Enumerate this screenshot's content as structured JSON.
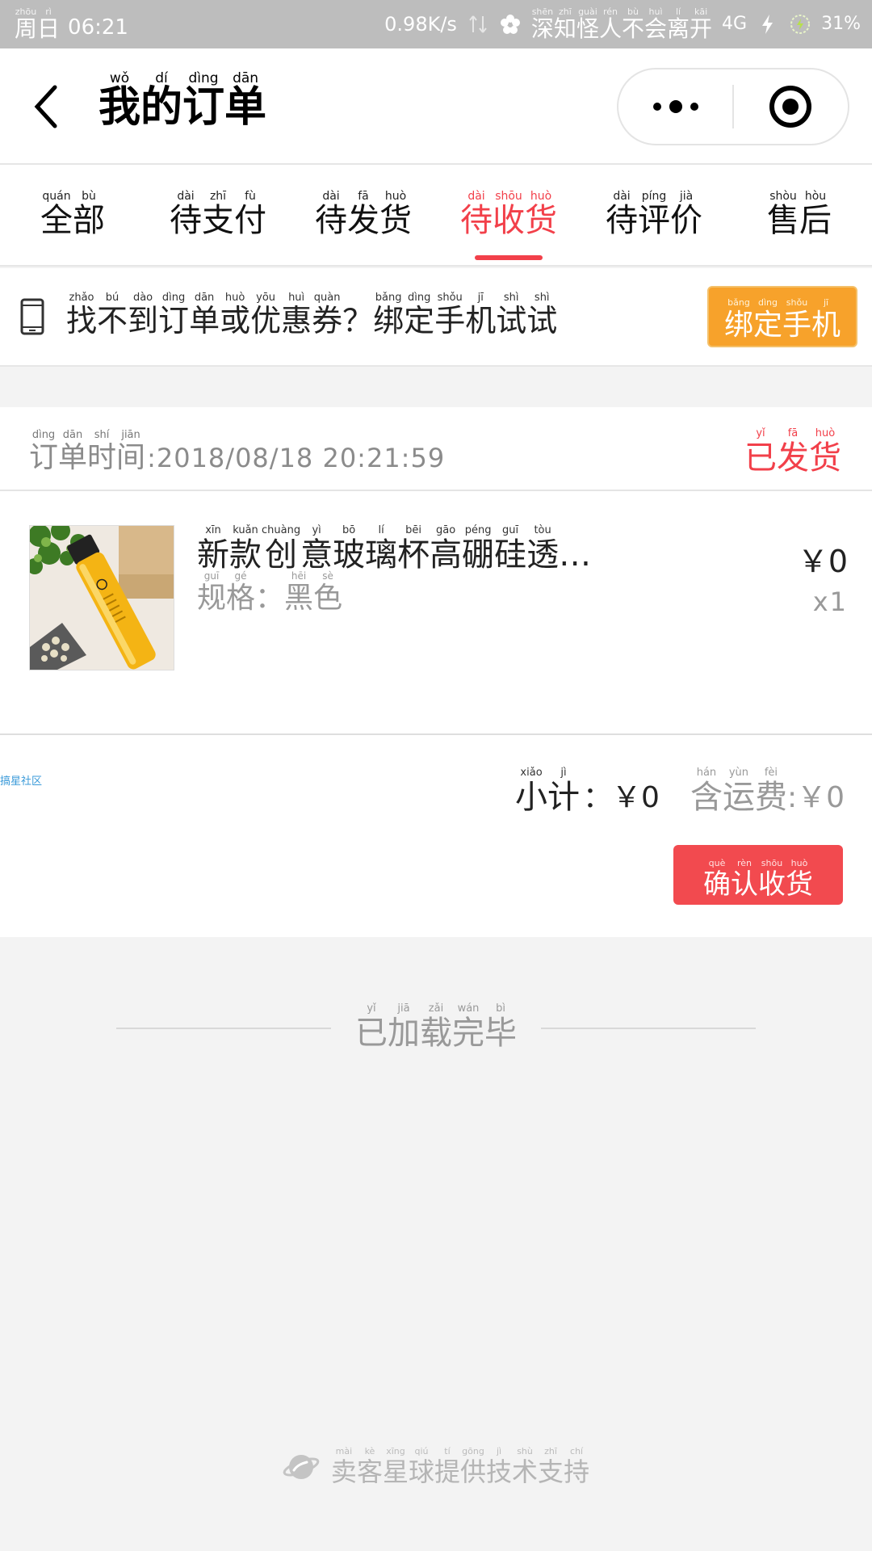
{
  "status_bar": {
    "day": {
      "pinyin": [
        "zhōu",
        "rì"
      ],
      "chars": [
        "周",
        "日"
      ]
    },
    "time": "06:21",
    "speed": "0.98K/s",
    "carrier": {
      "pinyin": [
        "shēn",
        "zhī",
        "guài",
        "rén",
        "bù",
        "huì",
        "lí",
        "kāi"
      ],
      "chars": [
        "深",
        "知",
        "怪",
        "人",
        "不",
        "会",
        "离",
        "开"
      ]
    },
    "network": "4G",
    "battery": "31%"
  },
  "nav": {
    "title": {
      "pinyin": [
        "wǒ",
        "dí",
        "dìng",
        "dān"
      ],
      "chars": [
        "我",
        "的",
        "订",
        "单"
      ]
    },
    "more_icon": "more-dots-icon",
    "close_icon": "target-circle-icon"
  },
  "tabs": [
    {
      "pinyin": [
        "quán",
        "bù"
      ],
      "chars": [
        "全",
        "部"
      ]
    },
    {
      "pinyin": [
        "dài",
        "zhī",
        "fù"
      ],
      "chars": [
        "待",
        "支",
        "付"
      ]
    },
    {
      "pinyin": [
        "dài",
        "fā",
        "huò"
      ],
      "chars": [
        "待",
        "发",
        "货"
      ]
    },
    {
      "pinyin": [
        "dài",
        "shōu",
        "huò"
      ],
      "chars": [
        "待",
        "收",
        "货"
      ]
    },
    {
      "pinyin": [
        "dài",
        "píng",
        "jià"
      ],
      "chars": [
        "待",
        "评",
        "价"
      ]
    },
    {
      "pinyin": [
        "shòu",
        "hòu"
      ],
      "chars": [
        "售",
        "后"
      ]
    }
  ],
  "active_tab_index": 3,
  "bind": {
    "text": {
      "pinyin": [
        "zhǎo",
        "bú",
        "dào",
        "dìng",
        "dān",
        "huò",
        "yōu",
        "huì",
        "quàn",
        "",
        "bǎng",
        "dìng",
        "shǒu",
        "jī",
        "shì",
        "shì"
      ],
      "chars": [
        "找",
        "不",
        "到",
        "订",
        "单",
        "或",
        "优",
        "惠",
        "券",
        "？",
        "绑",
        "定",
        "手",
        "机",
        "试",
        "试"
      ]
    },
    "button": {
      "pinyin": [
        "bǎng",
        "dìng",
        "shǒu",
        "jī"
      ],
      "chars": [
        "绑",
        "定",
        "手",
        "机"
      ]
    }
  },
  "order": {
    "time_label": {
      "pinyin": [
        "dìng",
        "dān",
        "shí",
        "jiān"
      ],
      "chars": [
        "订",
        "单",
        "时",
        "间"
      ]
    },
    "time_value": ":2018/08/18 20:21:59",
    "status": {
      "pinyin": [
        "yǐ",
        "fā",
        "huò"
      ],
      "chars": [
        "已",
        "发",
        "货"
      ]
    },
    "item": {
      "name": {
        "pinyin": [
          "xīn",
          "kuǎn",
          "chuàng",
          "yì",
          "bō",
          "lí",
          "bēi",
          "gāo",
          "péng",
          "guī",
          "tòu"
        ],
        "chars": [
          "新",
          "款",
          "创",
          "意",
          "玻",
          "璃",
          "杯",
          "高",
          "硼",
          "硅",
          "透"
        ]
      },
      "name_suffix": "…",
      "spec_label": {
        "pinyin": [
          "guī",
          "gé"
        ],
        "chars": [
          "规",
          "格"
        ]
      },
      "spec_sep": "：",
      "spec_value": {
        "pinyin": [
          "hēi",
          "sè"
        ],
        "chars": [
          "黑",
          "色"
        ]
      },
      "price": "￥0",
      "qty": "x1"
    },
    "watermark": "搞星社区",
    "subtotal_label": {
      "pinyin": [
        "xiǎo",
        "jì"
      ],
      "chars": [
        "小",
        "计"
      ]
    },
    "subtotal_value": "：￥0",
    "shipping_label": {
      "pinyin": [
        "hán",
        "yùn",
        "fèi"
      ],
      "chars": [
        "含",
        "运",
        "费"
      ]
    },
    "shipping_value": ":￥0",
    "confirm_button": {
      "pinyin": [
        "què",
        "rèn",
        "shōu",
        "huò"
      ],
      "chars": [
        "确",
        "认",
        "收",
        "货"
      ]
    }
  },
  "loaded": {
    "pinyin": [
      "yǐ",
      "jiā",
      "zǎi",
      "wán",
      "bì"
    ],
    "chars": [
      "已",
      "加",
      "载",
      "完",
      "毕"
    ]
  },
  "footer": {
    "icon": "planet-logo-icon",
    "text": {
      "pinyin": [
        "mài",
        "kè",
        "xīng",
        "qiú",
        "tí",
        "gōng",
        "jì",
        "shù",
        "zhī",
        "chí"
      ],
      "chars": [
        "卖",
        "客",
        "星",
        "球",
        "提",
        "供",
        "技",
        "术",
        "支",
        "持"
      ]
    }
  },
  "colors": {
    "accent": "#f2404a",
    "bind_button": "#f7a22b",
    "status_bar": "#bdbdbd"
  }
}
